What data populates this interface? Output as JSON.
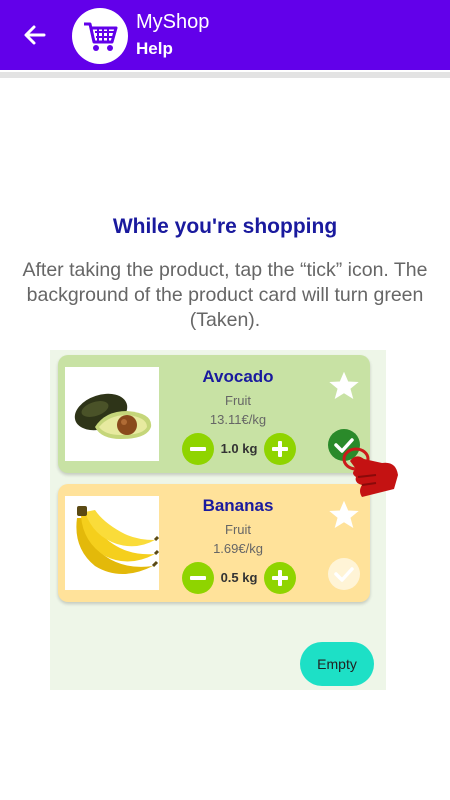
{
  "app_bar": {
    "title": "MyShop",
    "subtitle": "Help",
    "back_icon": "arrow-left-icon",
    "logo_icon": "shopping-cart-icon",
    "color": "#6200ea"
  },
  "help": {
    "heading": "While you're shopping",
    "description": "After taking the product, tap the “tick” icon. The background of the product card will turn green (Taken)."
  },
  "demo": {
    "products": [
      {
        "name": "Avocado",
        "category": "Fruit",
        "price": "13.11€/kg",
        "quantity": "1.0 kg",
        "status": "taken",
        "card_color": "#c8e2a4",
        "image_icon": "avocado-image",
        "favorite_icon": "star-icon",
        "tick_icon": "check-circle-icon"
      },
      {
        "name": "Bananas",
        "category": "Fruit",
        "price": "1.69€/kg",
        "quantity": "0.5 kg",
        "status": "not-taken",
        "card_color": "#ffe29a",
        "image_icon": "bananas-image",
        "favorite_icon": "star-icon",
        "tick_icon": "check-circle-icon"
      }
    ],
    "pointer_icon": "tap-hand-icon",
    "empty_button": "Empty",
    "accent_green": "#8fd400",
    "empty_color": "#1de0c6"
  }
}
